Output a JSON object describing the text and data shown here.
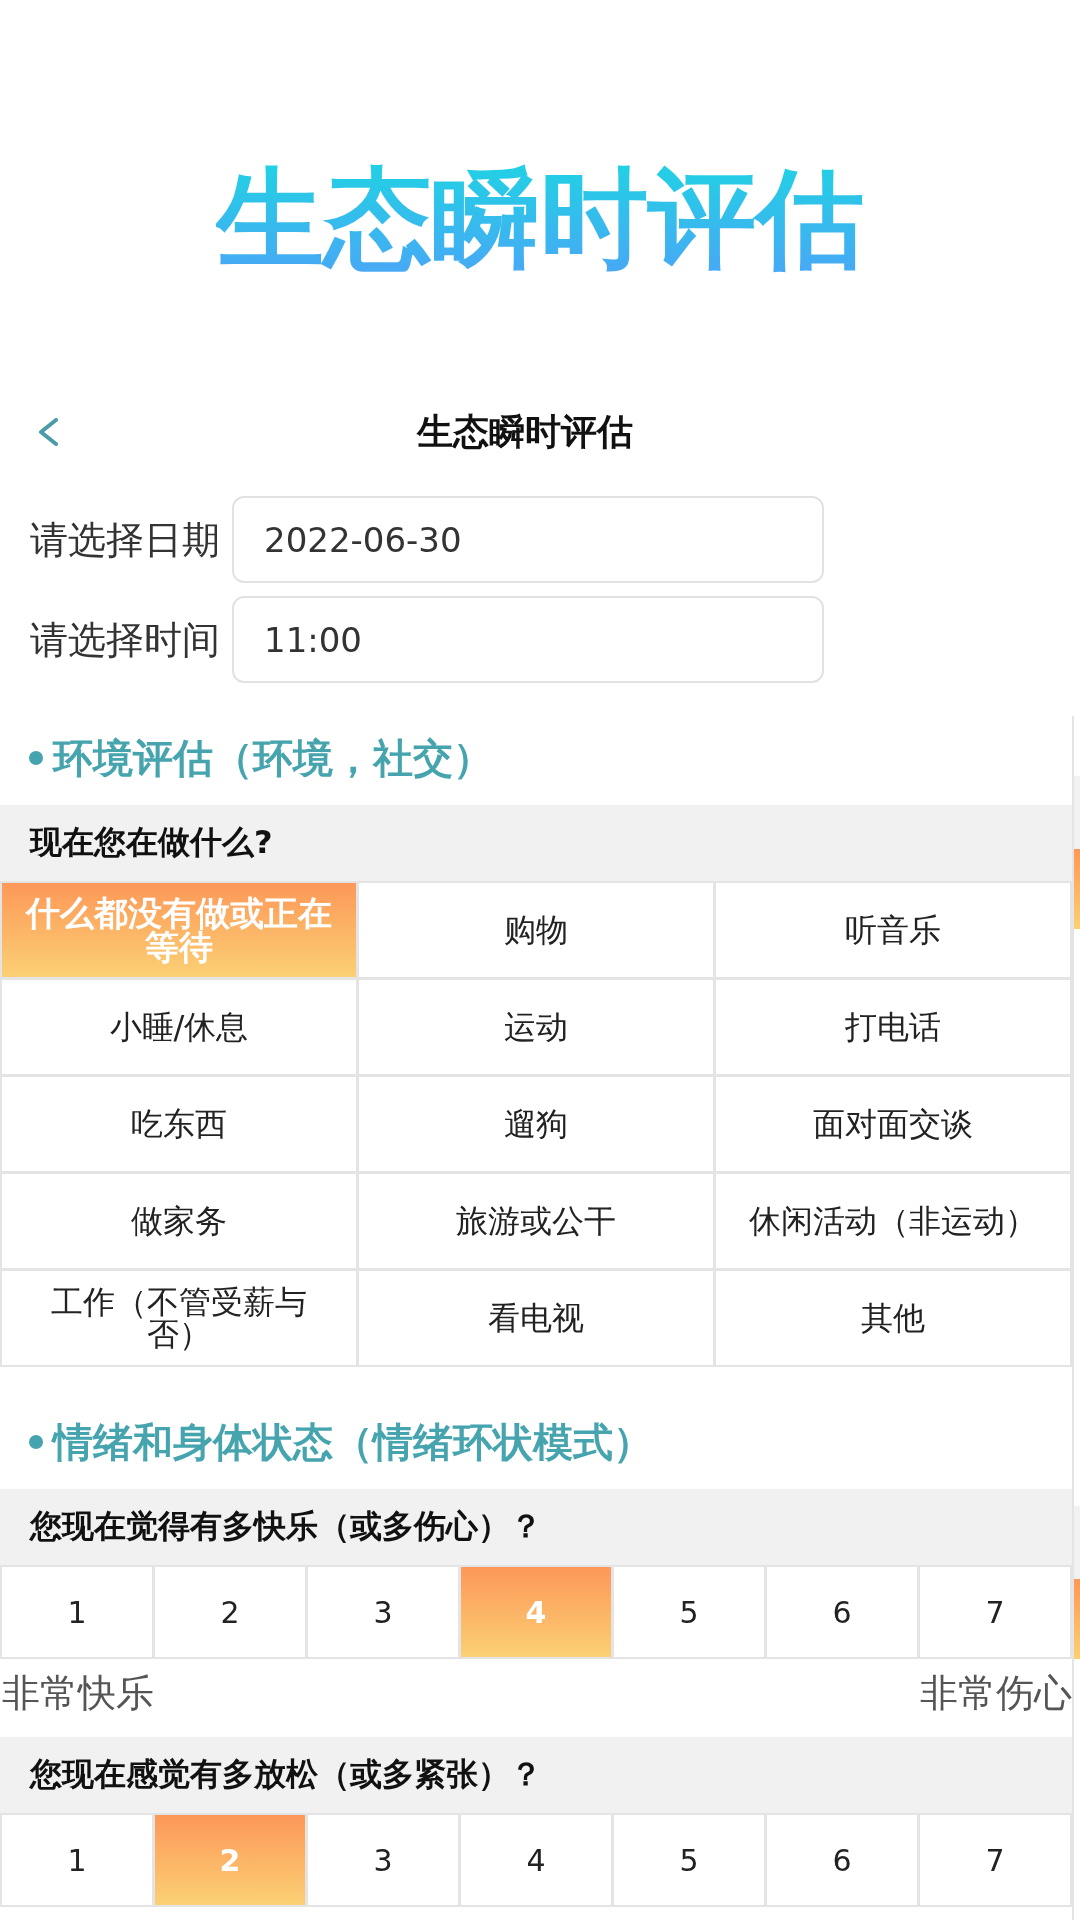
{
  "banner": {
    "title": "生态瞬时评估"
  },
  "nav_bar": {
    "title": "生态瞬时评估"
  },
  "form": {
    "fields": [
      {
        "label": "请选择日期",
        "value": "2022-06-30"
      },
      {
        "label": "请选择时间",
        "value": "11:00"
      }
    ]
  },
  "sections": [
    {
      "heading": "环境评估（环境，社交）",
      "questions": [
        {
          "kind": "grid",
          "prompt": "现在您在做什么?",
          "options": [
            {
              "label": "什么都没有做或正在等待",
              "selected": true
            },
            {
              "label": "购物",
              "selected": false
            },
            {
              "label": "听音乐",
              "selected": false
            },
            {
              "label": "小睡/休息",
              "selected": false
            },
            {
              "label": "运动",
              "selected": false
            },
            {
              "label": "打电话",
              "selected": false
            },
            {
              "label": "吃东西",
              "selected": false
            },
            {
              "label": "遛狗",
              "selected": false
            },
            {
              "label": "面对面交谈",
              "selected": false
            },
            {
              "label": "做家务",
              "selected": false
            },
            {
              "label": "旅游或公干",
              "selected": false
            },
            {
              "label": "休闲活动（非运动）",
              "selected": false
            },
            {
              "label": "工作（不管受薪与否）",
              "selected": false
            },
            {
              "label": "看电视",
              "selected": false
            },
            {
              "label": "其他",
              "selected": false
            }
          ]
        }
      ]
    },
    {
      "heading": "情绪和身体状态（情绪环状模式）",
      "questions": [
        {
          "kind": "scale",
          "prompt": "您现在觉得有多快乐（或多伤心）？",
          "options": [
            {
              "label": "1",
              "selected": false
            },
            {
              "label": "2",
              "selected": false
            },
            {
              "label": "3",
              "selected": false
            },
            {
              "label": "4",
              "selected": true
            },
            {
              "label": "5",
              "selected": false
            },
            {
              "label": "6",
              "selected": false
            },
            {
              "label": "7",
              "selected": false
            }
          ],
          "low_label": "非常快乐",
          "high_label": "非常伤心"
        },
        {
          "kind": "scale",
          "prompt": "您现在感觉有多放松（或多紧张）？",
          "options": [
            {
              "label": "1",
              "selected": false
            },
            {
              "label": "2",
              "selected": true
            },
            {
              "label": "3",
              "selected": false
            },
            {
              "label": "4",
              "selected": false
            },
            {
              "label": "5",
              "selected": false
            },
            {
              "label": "6",
              "selected": false
            },
            {
              "label": "7",
              "selected": false
            }
          ]
        }
      ]
    }
  ]
}
